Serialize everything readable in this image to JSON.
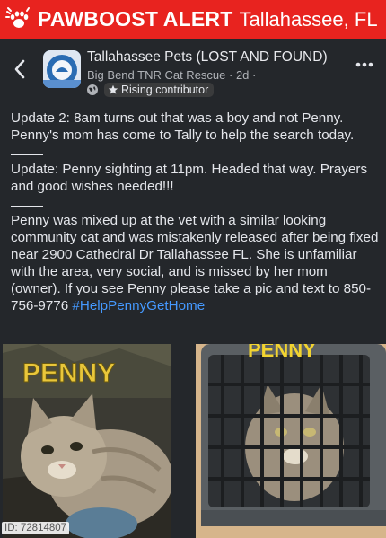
{
  "banner": {
    "brand": "PAWBOOST ALERT",
    "city": "Tallahassee, FL",
    "color": "#e8231f"
  },
  "header": {
    "back_icon": "back-arrow-icon",
    "group_name": "Tallahassee Pets (LOST AND FOUND)",
    "author": "Big Bend TNR Cat Rescue",
    "time": "· 2d ·",
    "badge": "Rising contributor",
    "more_icon": "more-options-icon"
  },
  "post": {
    "update2": "Update 2: 8am  turns out that was a boy and not Penny. Penny's mom has come to Tally to help the search today.",
    "update1": "Update: Penny sighting at 11pm. Headed that way. Prayers and good wishes needed!!!",
    "main": "Penny was mixed up at the vet with a similar looking community cat and was mistakenly released after being fixed near 2900 Cathedral Dr Tallahassee FL. She is unfamiliar with the area, very social, and is missed by her mom (owner). If you see Penny please take a pic and text to 850-756-9776",
    "hashtag": "#HelpPennyGetHome",
    "hashtag_color": "#4599ff"
  },
  "photos": {
    "photo1_caption": "PENNY",
    "photo2_caption": "PENNY"
  },
  "watermark": {
    "id": "ID: 72814807"
  }
}
